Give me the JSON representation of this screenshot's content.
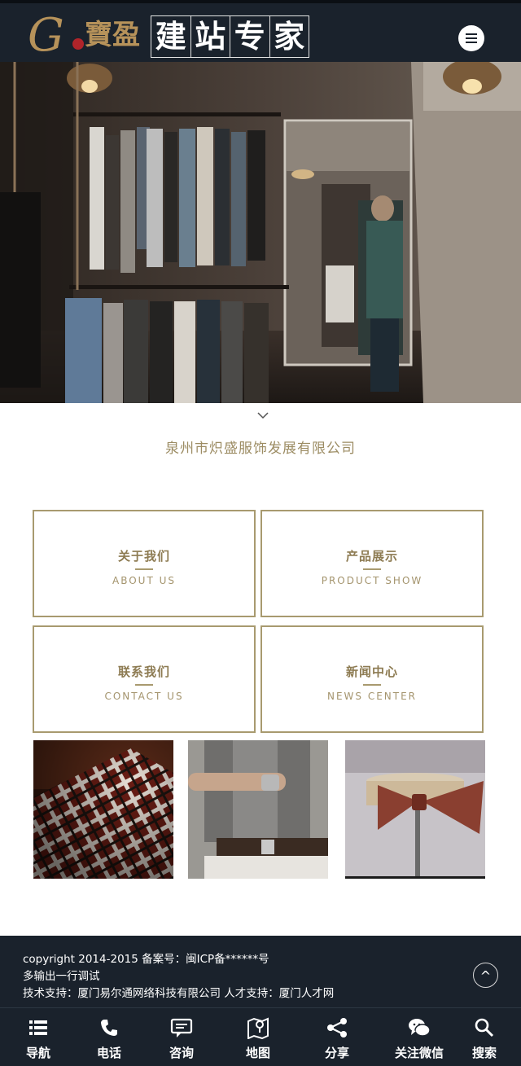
{
  "header": {
    "logo_script": "寶盈",
    "logo_chars": [
      "建",
      "站",
      "专",
      "家"
    ],
    "menu_icon": "hamburger-menu-icon"
  },
  "intro": {
    "company_name": "泉州市炽盛服饰发展有限公司",
    "arrow_icon": "chevron-down-icon"
  },
  "nav_boxes": [
    {
      "cn": "关于我们",
      "en": "ABOUT US"
    },
    {
      "cn": "产品展示",
      "en": "PRODUCT SHOW"
    },
    {
      "cn": "联系我们",
      "en": "CONTACT US"
    },
    {
      "cn": "新闻中心",
      "en": "NEWS CENTER"
    }
  ],
  "footer": {
    "line1": "copyright 2014-2015 备案号：闽ICP备******号",
    "line2": "多输出一行调试",
    "line3": "技术支持：厦门易尔通网络科技有限公司 人才支持：厦门人才网",
    "top_label": "^"
  },
  "bottom_nav": [
    {
      "label": "导航",
      "icon": "list-icon"
    },
    {
      "label": "电话",
      "icon": "phone-icon"
    },
    {
      "label": "咨询",
      "icon": "chat-icon"
    },
    {
      "label": "地图",
      "icon": "map-icon"
    },
    {
      "label": "分享",
      "icon": "share-icon"
    },
    {
      "label": "关注微信",
      "icon": "wechat-icon"
    },
    {
      "label": "搜索",
      "icon": "search-icon"
    }
  ],
  "colors": {
    "header_bg": "#1a222c",
    "accent_gold": "#a89a6f",
    "company_text": "#9c8c63"
  }
}
